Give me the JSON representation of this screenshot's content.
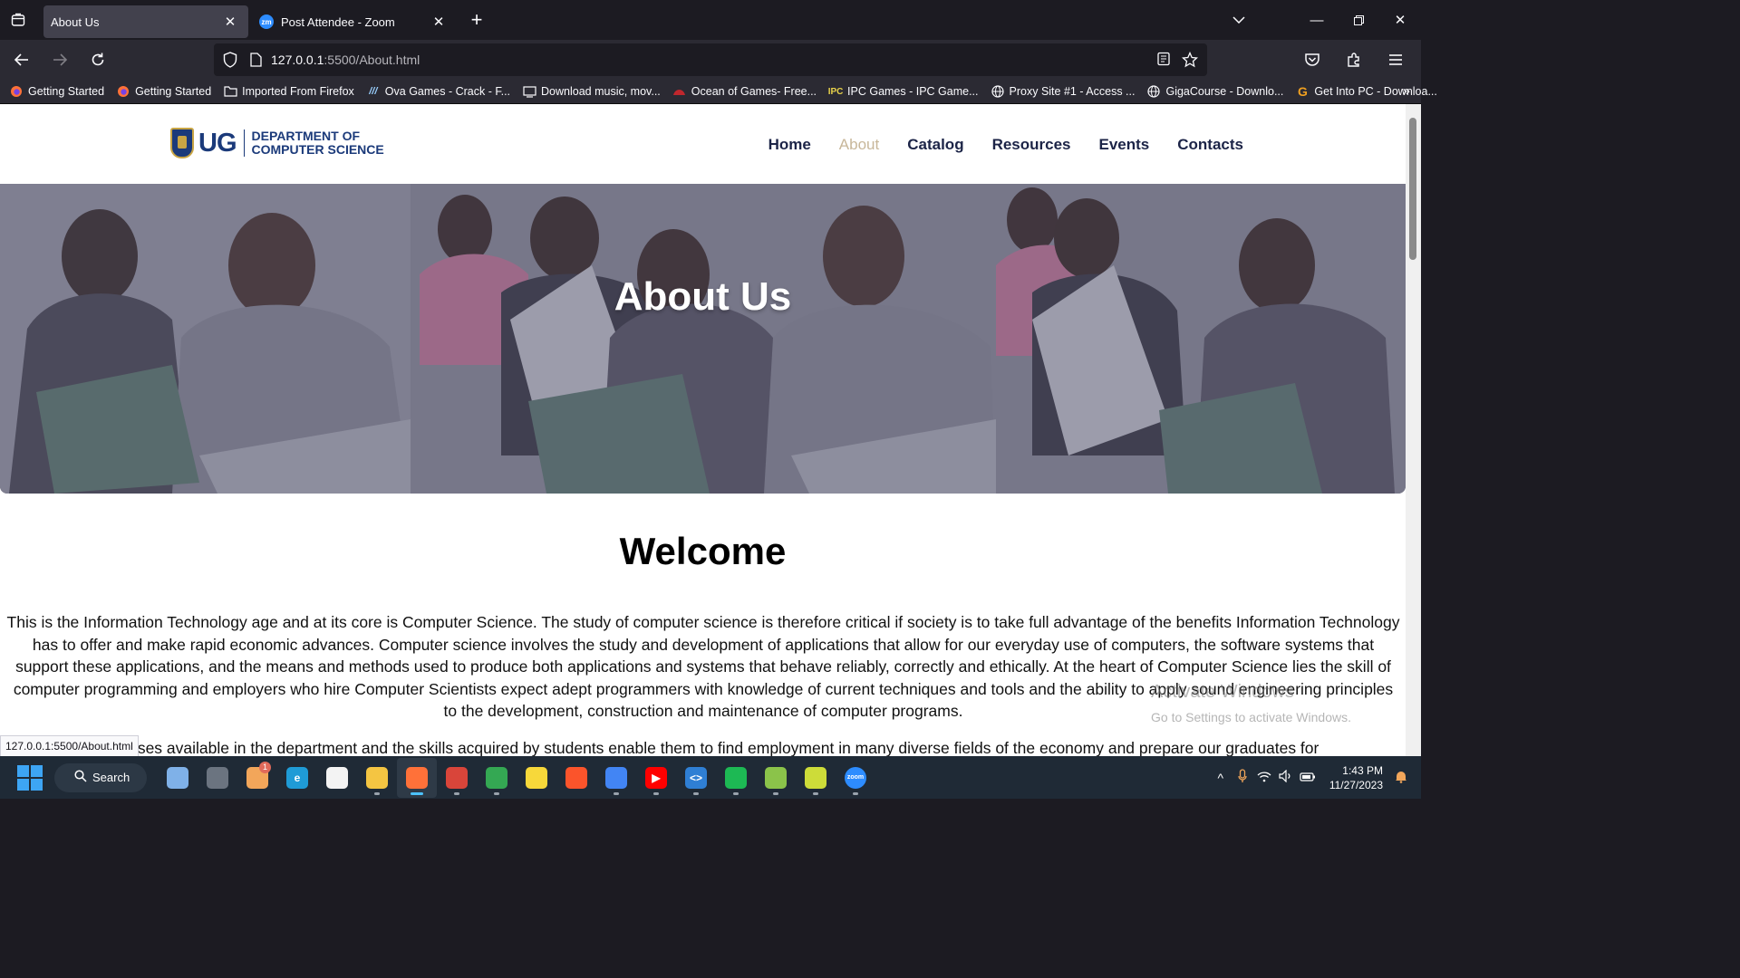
{
  "browser": {
    "tabs": [
      {
        "title": "About Us",
        "active": true
      },
      {
        "title": "Post Attendee - Zoom",
        "active": false,
        "favicon": "zm"
      }
    ],
    "url_host": "127.0.0.1",
    "url_rest": ":5500/About.html",
    "bookmarks": [
      {
        "label": "Getting Started",
        "icon": "firefox-icon"
      },
      {
        "label": "Getting Started",
        "icon": "firefox-icon"
      },
      {
        "label": "Imported From Firefox",
        "icon": "folder-icon"
      },
      {
        "label": "Ova Games - Crack - F...",
        "icon": "ova-icon"
      },
      {
        "label": "Download music, mov...",
        "icon": "download-site-icon"
      },
      {
        "label": "Ocean of Games- Free...",
        "icon": "ocean-icon"
      },
      {
        "label": "IPC Games - IPC Game...",
        "icon": "ipc-icon"
      },
      {
        "label": "Proxy Site #1 - Access ...",
        "icon": "globe-icon"
      },
      {
        "label": "GigaCourse - Downlo...",
        "icon": "globe-icon"
      },
      {
        "label": "Get Into PC - Downloa...",
        "icon": "getintopc-icon"
      }
    ],
    "status_url": "127.0.0.1:5500/About.html"
  },
  "site": {
    "logo_ug": "UG",
    "logo_line1": "DEPARTMENT OF",
    "logo_line2": "COMPUTER SCIENCE",
    "nav": [
      "Home",
      "About",
      "Catalog",
      "Resources",
      "Events",
      "Contacts"
    ],
    "current_nav": "About",
    "hero_title": "About Us",
    "welcome_title": "Welcome",
    "intro_text": "This is the Information Technology age and at its core is Computer Science. The study of computer science is therefore critical if society is to take full advantage of the benefits Information Technology has to offer and make rapid economic advances. Computer science involves the study and development of applications that allow for our everyday use of computers, the software systems that support these applications, and the means and methods used to produce both applications and systems that behave reliably, correctly and ethically. At the heart of Computer Science lies the skill of computer programming and employers who hire Computer Scientists expect adept programmers with knowledge of current techniques and tools and the ability to apply sound engineering principles to the development, construction and maintenance of computer programs.",
    "second_text_visible": "rses available in the department and the skills acquired by students enable them to find employment in many diverse fields of the economy and prepare our graduates for"
  },
  "watermark": {
    "line1": "Activate Windows",
    "line2": "Go to Settings to activate Windows."
  },
  "taskbar": {
    "search_label": "Search",
    "apps": [
      {
        "name": "widgets-icon",
        "color": "#7fb1e8",
        "glyph": ""
      },
      {
        "name": "task-view-icon",
        "color": "#6b7480",
        "glyph": ""
      },
      {
        "name": "photos-icon",
        "color": "#f2a65a",
        "glyph": "",
        "badge": "1"
      },
      {
        "name": "edge-icon",
        "color": "#1f9bd6",
        "glyph": "e"
      },
      {
        "name": "store-icon",
        "color": "#f3f3f3",
        "glyph": ""
      },
      {
        "name": "file-explorer-icon",
        "color": "#f4c542",
        "glyph": ""
      },
      {
        "name": "firefox-icon",
        "color": "#ff7139",
        "glyph": "",
        "active": true
      },
      {
        "name": "ccleaner-icon",
        "color": "#d9453a",
        "glyph": ""
      },
      {
        "name": "chrome-icon",
        "color": "#34a853",
        "glyph": ""
      },
      {
        "name": "sticky-notes-icon",
        "color": "#f7d83a",
        "glyph": ""
      },
      {
        "name": "brave-icon",
        "color": "#fb542b",
        "glyph": ""
      },
      {
        "name": "chrome-profile-icon",
        "color": "#4285f4",
        "glyph": ""
      },
      {
        "name": "youtube-icon",
        "color": "#ff0000",
        "glyph": "▶"
      },
      {
        "name": "vscode-icon",
        "color": "#2f7fd4",
        "glyph": "<>"
      },
      {
        "name": "spotify-icon",
        "color": "#1db954",
        "glyph": ""
      },
      {
        "name": "bluestacks-icon",
        "color": "#8bc34a",
        "glyph": ""
      },
      {
        "name": "bluestacks-x-icon",
        "color": "#cddc39",
        "glyph": ""
      },
      {
        "name": "zoom-icon",
        "color": "#2d8cff",
        "glyph": "zoom"
      }
    ],
    "time": "1:43 PM",
    "date": "11/27/2023"
  }
}
